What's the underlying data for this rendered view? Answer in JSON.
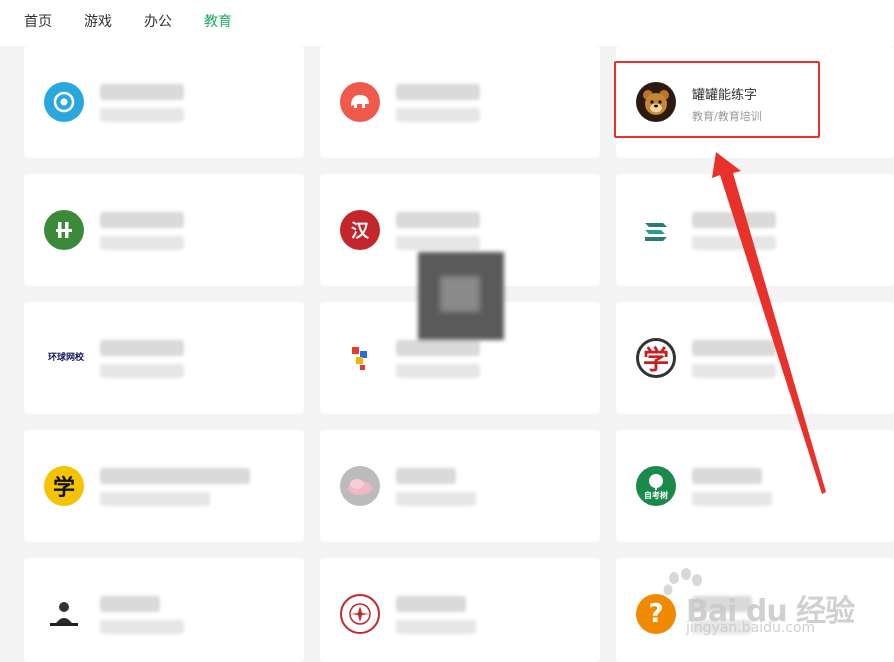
{
  "nav": {
    "tabs": [
      {
        "label": "首页"
      },
      {
        "label": "游戏"
      },
      {
        "label": "办公"
      },
      {
        "label": "教育"
      }
    ],
    "active_tab": "教育"
  },
  "cards": [
    {
      "icon": "target-icon",
      "icon_color": "#2ba7e0",
      "name": "",
      "category": ""
    },
    {
      "icon": "elephant-icon",
      "icon_color": "#f05a4a",
      "name": "",
      "category": ""
    },
    {
      "icon": "bear-avatar-icon",
      "icon_color": "#2b1a10",
      "name": "罐罐能练字",
      "category": "教育/教育培训"
    },
    {
      "icon": "leaf-logo-icon",
      "icon_color": "#3a8a3a",
      "name": "",
      "category": ""
    },
    {
      "icon": "han-char-icon",
      "icon_color": "#c3272b",
      "icon_text": "汉",
      "name": "",
      "category": ""
    },
    {
      "icon": "wave-logo-icon",
      "icon_color": "#2a7a7a",
      "name": "",
      "category": ""
    },
    {
      "icon": "brand-logo-icon",
      "icon_color": "#ffffff",
      "icon_text": "环球网校",
      "name": "",
      "category": ""
    },
    {
      "icon": "blocks-icon",
      "icon_color": "#ffffff",
      "name": "",
      "category": ""
    },
    {
      "icon": "xue-char-icon",
      "icon_color": "#ffffff",
      "icon_text": "学",
      "name": "",
      "category": ""
    },
    {
      "icon": "xue-yellow-icon",
      "icon_color": "#f5c400",
      "icon_text": "学",
      "name": "",
      "category": ""
    },
    {
      "icon": "lotus-icon",
      "icon_color": "#bbbbbb",
      "name": "",
      "category": ""
    },
    {
      "icon": "tree-icon",
      "icon_color": "#1a8a4a",
      "icon_text": "自考树",
      "name": "",
      "category": ""
    },
    {
      "icon": "person-icon",
      "icon_color": "#ffffff",
      "name": "",
      "category": ""
    },
    {
      "icon": "emblem-icon",
      "icon_color": "#ffffff",
      "name": "",
      "category": ""
    },
    {
      "icon": "question-icon",
      "icon_color": "#f28a00",
      "icon_text": "?",
      "name": "",
      "category": ""
    }
  ],
  "annotation": {
    "highlight_color": "#e8312a"
  },
  "watermark": {
    "brand": "Bai du 经验",
    "url": "jingyan.baidu.com"
  }
}
